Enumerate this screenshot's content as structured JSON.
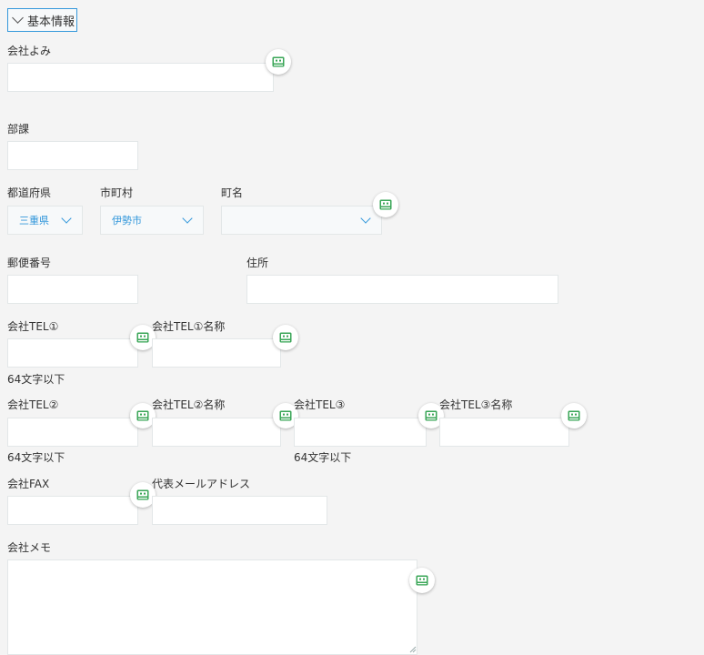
{
  "section": {
    "title": "基本情報"
  },
  "fields": {
    "company_kana": {
      "label": "会社よみ",
      "value": ""
    },
    "department": {
      "label": "部課",
      "value": ""
    },
    "prefecture": {
      "label": "都道府県",
      "value": "三重県"
    },
    "city": {
      "label": "市町村",
      "value": "伊勢市"
    },
    "town": {
      "label": "町名",
      "value": ""
    },
    "postal": {
      "label": "郵便番号",
      "value": ""
    },
    "address": {
      "label": "住所",
      "value": ""
    },
    "tel1": {
      "label": "会社TEL①",
      "note": "64文字以下",
      "value": ""
    },
    "tel1_name": {
      "label": "会社TEL①名称",
      "value": ""
    },
    "tel2": {
      "label": "会社TEL②",
      "note": "64文字以下",
      "value": ""
    },
    "tel2_name": {
      "label": "会社TEL②名称",
      "value": ""
    },
    "tel3": {
      "label": "会社TEL③",
      "note": "64文字以下",
      "value": ""
    },
    "tel3_name": {
      "label": "会社TEL③名称",
      "value": ""
    },
    "fax": {
      "label": "会社FAX",
      "value": ""
    },
    "email": {
      "label": "代表メールアドレス",
      "value": ""
    },
    "memo": {
      "label": "会社メモ",
      "value": ""
    }
  },
  "icons": {
    "field_badge": "green-terminal-icon"
  },
  "colors": {
    "accent": "#3498db",
    "badge_green": "#3aa657",
    "background": "#f4f4f4"
  }
}
